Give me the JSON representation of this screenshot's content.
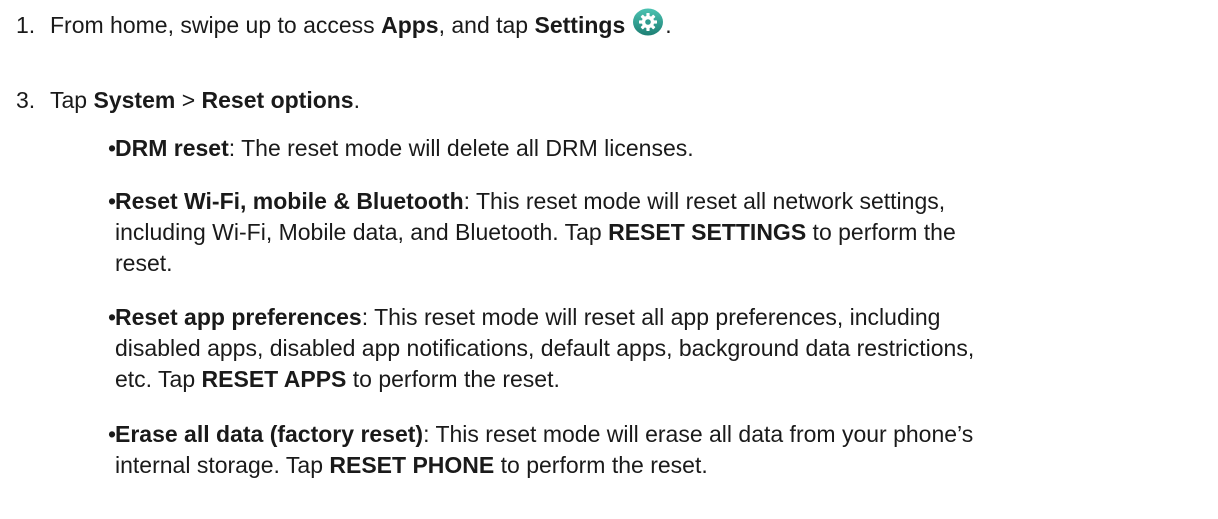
{
  "steps": [
    {
      "number": "1.",
      "parts": {
        "t1": "From home, swipe up to access ",
        "b1": "Apps",
        "t2": ", and tap ",
        "b2": "Settings",
        "t3": "."
      },
      "icon": "settings-gear-icon"
    },
    {
      "number": "3.",
      "parts": {
        "t1": "Tap ",
        "b1": "System",
        "t2": " > ",
        "b2": "Reset options",
        "t3": "."
      }
    }
  ],
  "bullets": [
    {
      "dot": "•",
      "bold": "DRM reset",
      "text": ": The reset mode will delete all DRM licenses."
    },
    {
      "dot": "•",
      "bold": "Reset Wi-Fi, mobile & Bluetooth",
      "text1": ": This reset mode will reset all network settings, including Wi-Fi, Mobile data, and Bluetooth. Tap ",
      "bold2": "RESET SETTINGS",
      "text2": " to perform the reset."
    },
    {
      "dot": "•",
      "bold": "Reset app preferences",
      "text1": ": This reset mode will reset all app preferences, including disabled apps, disabled app notifications, default apps, background data restrictions, etc. Tap ",
      "bold2": "RESET APPS",
      "text2": " to perform the reset."
    },
    {
      "dot": "•",
      "bold": "Erase all data (factory reset)",
      "text1": ": This reset mode will erase all data from your phone’s internal storage. Tap ",
      "bold2": "RESET PHONE",
      "text2": " to perform the reset."
    }
  ],
  "colors": {
    "text": "#1a1a1a",
    "icon_bg": "#2e9b8f"
  }
}
